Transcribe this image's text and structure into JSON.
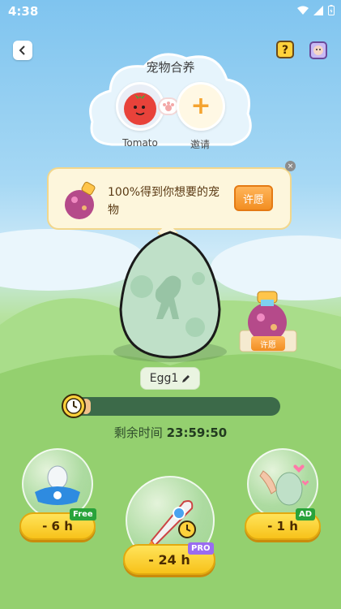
{
  "status_bar": {
    "time": "4:38",
    "icons": [
      "wifi-icon",
      "signal-icon",
      "battery-icon"
    ]
  },
  "header": {
    "back_icon": "chevron-left-icon",
    "help_icon": "question-icon",
    "book_icon": "pet-book-icon"
  },
  "merge": {
    "title": "宠物合养",
    "left_pet_label": "Tomato",
    "right_label": "邀请",
    "plus": "+"
  },
  "wish_banner": {
    "text": "100%得到你想要的宠物",
    "button_label": "许愿",
    "close": "×"
  },
  "egg": {
    "name": "Egg1"
  },
  "side_potion": {
    "button_label": "许愿"
  },
  "timer": {
    "label_prefix": "剩余时间",
    "remaining": "23:59:50",
    "progress_fraction": 0.03
  },
  "boosts": [
    {
      "label": "- 6 h",
      "tag": "Free"
    },
    {
      "label": "- 24 h",
      "tag": "PRO"
    },
    {
      "label": "- 1 h",
      "tag": "AD"
    }
  ],
  "colors": {
    "accent_orange": "#f28e22",
    "button_yellow": "#f7c21a",
    "progress_track": "#3c6a49"
  }
}
